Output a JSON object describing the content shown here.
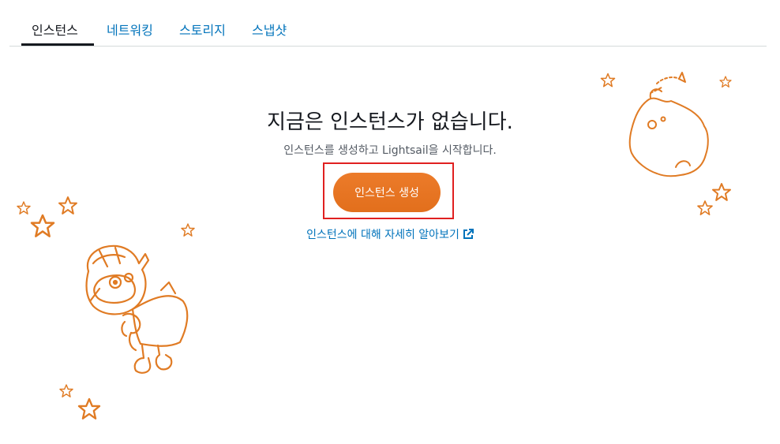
{
  "tabs": [
    {
      "label": "인스턴스",
      "active": true
    },
    {
      "label": "네트워킹",
      "active": false
    },
    {
      "label": "스토리지",
      "active": false
    },
    {
      "label": "스냅샷",
      "active": false
    }
  ],
  "empty_state": {
    "title": "지금은 인스턴스가 없습니다.",
    "subtitle": "인스턴스를 생성하고 Lightsail을 시작합니다.",
    "create_button_label": "인스턴스 생성",
    "learn_more_label": "인스턴스에 대해 자세히 알아보기"
  },
  "icons": {
    "external_link": "external-link-icon",
    "stars": "star-icon",
    "astronaut": "astronaut-illustration",
    "planet": "planet-illustration"
  },
  "colors": {
    "accent": "#ec7211",
    "link": "#0073bb",
    "highlight": "#e02020",
    "text": "#16191f",
    "muted": "#545b64"
  }
}
